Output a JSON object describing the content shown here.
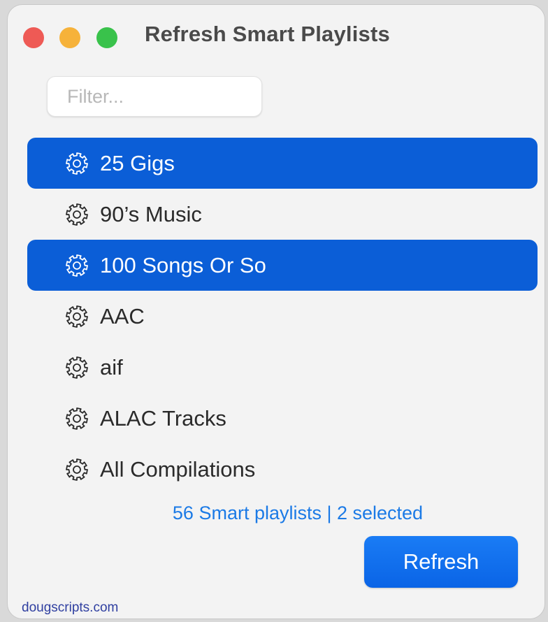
{
  "window": {
    "title": "Refresh Smart Playlists"
  },
  "filter": {
    "placeholder": "Filter...",
    "value": ""
  },
  "playlists": [
    {
      "label": "25 Gigs",
      "selected": true
    },
    {
      "label": "90’s Music",
      "selected": false
    },
    {
      "label": "100 Songs Or So",
      "selected": true
    },
    {
      "label": "AAC",
      "selected": false
    },
    {
      "label": "aif",
      "selected": false
    },
    {
      "label": "ALAC Tracks",
      "selected": false
    },
    {
      "label": "All Compilations",
      "selected": false
    }
  ],
  "icons": {
    "playlist": "gear-icon"
  },
  "status": {
    "text": "56 Smart playlists | 2 selected"
  },
  "actions": {
    "refresh_label": "Refresh"
  },
  "footer": {
    "credit": "dougscripts.com"
  },
  "colors": {
    "selection": "#0b5ed7",
    "accent": "#1b7ae6",
    "button": "#0e6ff0",
    "close": "#ee5a55",
    "minimize": "#f6b23a",
    "maximize": "#39c24b"
  }
}
